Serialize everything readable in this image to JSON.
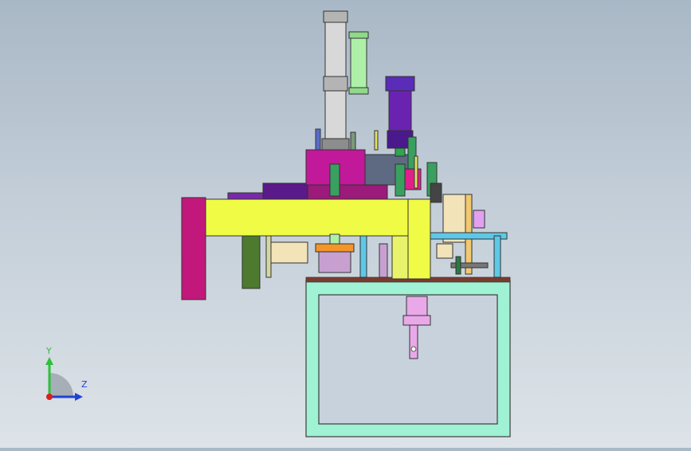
{
  "viewport": {
    "orientation_triad": {
      "y_label": "Y",
      "z_label": "Z",
      "y_color": "#2fbf3a",
      "z_color": "#2142d6",
      "x_color": "#d91f1f"
    }
  },
  "colors": {
    "background_top": "#a9b8c6",
    "background_bottom": "#dde3e8",
    "frame": "#9ff2d4",
    "beam": "#f0fb45",
    "magenta": "#c2187c",
    "cylinder": "#c9c9c9",
    "light_green": "#aef0a8",
    "purple": "#6a22b0"
  }
}
